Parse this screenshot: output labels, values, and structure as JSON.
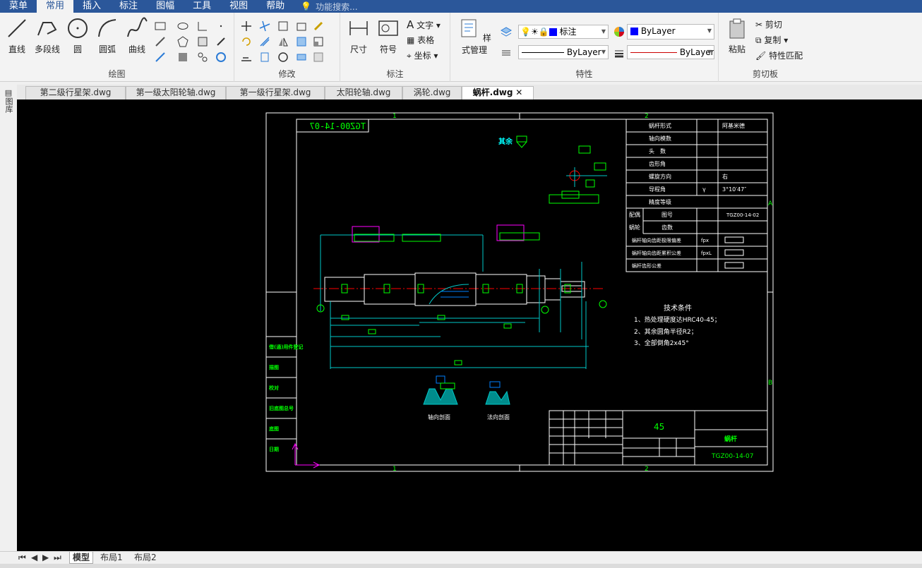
{
  "menubar": {
    "items": [
      "菜单",
      "常用",
      "插入",
      "标注",
      "图幅",
      "工具",
      "视图",
      "帮助"
    ],
    "active_index": 1,
    "search_placeholder": "功能搜索..."
  },
  "ribbon": {
    "draw": {
      "group_label": "绘图",
      "buttons": [
        "直线",
        "多段线",
        "圆",
        "圆弧",
        "曲线"
      ]
    },
    "modify": {
      "group_label": "修改"
    },
    "annotate": {
      "group_label": "标注",
      "dim_label": "尺寸",
      "symbol_label": "符号",
      "text_label": "文字",
      "table_label": "表格",
      "coord_label": "坐标"
    },
    "properties": {
      "group_label": "特性",
      "style_label": "样式管理",
      "layer_name": "标注",
      "color_value": "ByLayer",
      "linetype_value": "ByLayer",
      "lineweight_value": "ByLayer"
    },
    "clipboard": {
      "group_label": "剪切板",
      "paste_label": "粘贴",
      "cut_label": "剪切",
      "copy_label": "复制",
      "match_label": "特性匹配"
    }
  },
  "side_panel_label": "图库",
  "file_tabs": [
    "第二级行星架.dwg",
    "第一级太阳轮轴.dwg",
    "第一级行星架.dwg",
    "太阳轮轴.dwg",
    "涡轮.dwg",
    "蜗杆.dwg"
  ],
  "active_tab_index": 5,
  "drawing": {
    "code_mirrored": "TGZ00-14-07",
    "rough_note": "其余",
    "table_rows": [
      "蜗杆形式",
      "轴向模数",
      "头　数",
      "齿形角",
      "螺旋方向",
      "导程角",
      "精度等级"
    ],
    "table_values": [
      "阿基米德",
      "",
      "",
      "",
      "右",
      "3°10′47″",
      ""
    ],
    "lead_symbol": "γ",
    "mate_label_1": "配偶",
    "mate_label_2": "蜗轮",
    "mate_rows": [
      "图号",
      "齿数"
    ],
    "mate_value": "TGZ00-14-02",
    "tol_rows": [
      "蜗杆轴向齿距极限偏差",
      "蜗杆轴向齿距累积公差",
      "蜗杆齿形公差"
    ],
    "tol_symbols": [
      "fpx",
      "fpxL",
      ""
    ],
    "tech_title": "技术条件",
    "tech_items": [
      "1、热处理硬度达HRC40-45；",
      "2、其余圆角半径R2；",
      "3、全部倒角2x45°"
    ],
    "section_labels": [
      "轴向剖面",
      "法向剖面"
    ],
    "material": "45",
    "part_name": "蜗杆",
    "drawing_code": "TGZ00-14-07",
    "zone_top": [
      "1",
      "2"
    ],
    "zone_side": [
      "A",
      "B"
    ],
    "side_labels": [
      "借(通)用件登记",
      "描图",
      "校对",
      "旧底图总号",
      "底图",
      "日期"
    ]
  },
  "layout_tabs": [
    "模型",
    "布局1",
    "布局2"
  ],
  "colors": {
    "menubar_bg": "#2b579a",
    "canvas_bg": "#000000",
    "frame_white": "#ffffff",
    "geometry_green": "#00ff00",
    "center_red": "#ff0000",
    "dimension_cyan": "#00c8c8",
    "magenta": "#ff00ff"
  }
}
